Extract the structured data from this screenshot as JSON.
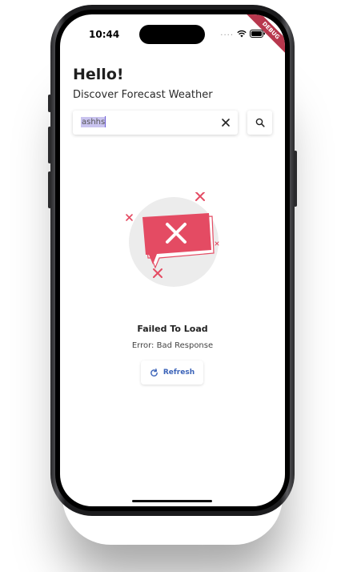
{
  "status_bar": {
    "time": "10:44",
    "signal_dots": "....",
    "debug_banner": "DEBUG"
  },
  "header": {
    "greeting": "Hello!",
    "subtitle": "Discover Forecast Weather"
  },
  "search": {
    "value": "ashhs"
  },
  "error_state": {
    "title": "Failed To Load",
    "message": "Error: Bad Response",
    "refresh_label": "Refresh"
  },
  "colors": {
    "error_accent": "#e44b63",
    "refresh_accent": "#3b63b8",
    "debug_banner": "#b7374d"
  }
}
